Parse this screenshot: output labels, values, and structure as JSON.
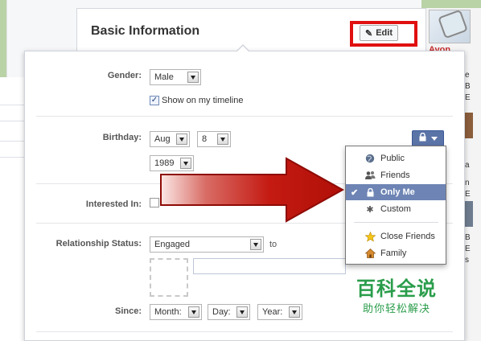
{
  "section": {
    "title": "Basic Information",
    "edit_label": "Edit"
  },
  "sidebar_ad": {
    "brand": "Avon",
    "snippets": [
      "e",
      "B",
      "E",
      "a",
      "n",
      "E",
      "B",
      "E",
      "s"
    ]
  },
  "fields": {
    "gender": {
      "label": "Gender:",
      "value": "Male",
      "show_on_timeline": "Show on my timeline",
      "show_checked": true
    },
    "birthday": {
      "label": "Birthday:",
      "month": "Aug",
      "day": "8",
      "year": "1989"
    },
    "interested_in": {
      "label": "Interested In:"
    },
    "relationship": {
      "label": "Relationship Status:",
      "value": "Engaged",
      "to_label": "to"
    },
    "since": {
      "label": "Since:",
      "month": "Month:",
      "day": "Day:",
      "year": "Year:"
    }
  },
  "privacy_menu": {
    "items": [
      {
        "label": "Public",
        "icon": "globe-icon",
        "selected": false
      },
      {
        "label": "Friends",
        "icon": "friends-icon",
        "selected": false
      },
      {
        "label": "Only Me",
        "icon": "lock-icon",
        "selected": true
      },
      {
        "label": "Custom",
        "icon": "gear-icon",
        "selected": false
      },
      {
        "label": "Close Friends",
        "icon": "star-icon",
        "selected": false
      },
      {
        "label": "Family",
        "icon": "house-icon",
        "selected": false
      }
    ]
  },
  "watermark": {
    "line1": "百科全说",
    "line2": "助你轻松解决"
  },
  "colors": {
    "accent": "#3b5998",
    "highlight": "#e01010",
    "arrow": "#c41a12",
    "selected": "#6d84b4",
    "watermark": "#2a9d4b"
  }
}
